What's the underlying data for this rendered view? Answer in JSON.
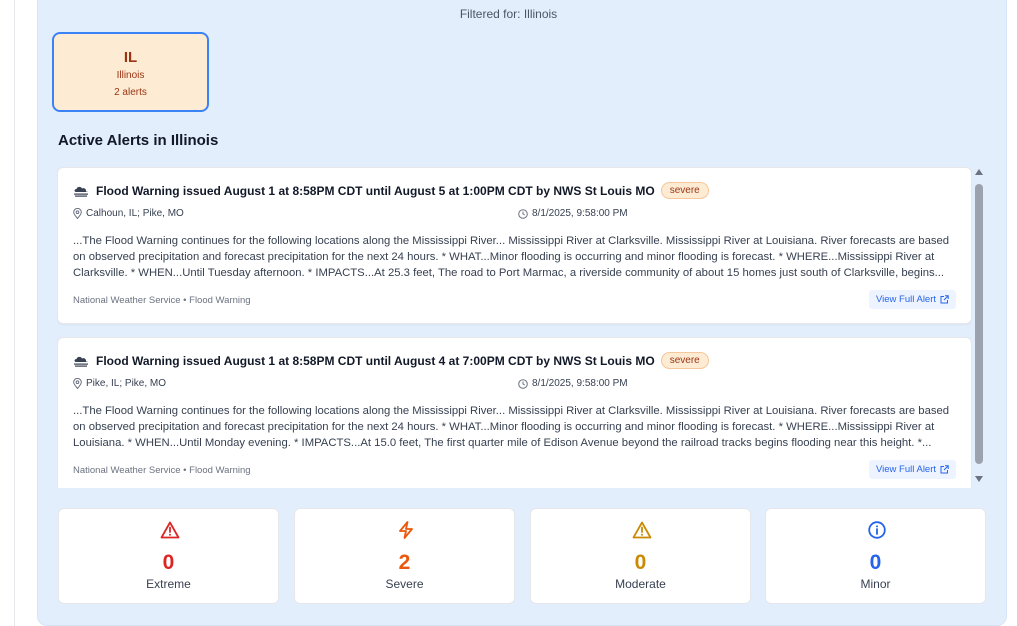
{
  "filter_label": "Filtered for: Illinois",
  "state_card": {
    "code": "IL",
    "name": "Illinois",
    "count": "2 alerts"
  },
  "section_title": "Active Alerts in Illinois",
  "alerts": [
    {
      "title": "Flood Warning issued August 1 at 8:58PM CDT until August 5 at 1:00PM CDT by NWS St Louis MO",
      "severity": "severe",
      "location": "Calhoun, IL; Pike, MO",
      "time": "8/1/2025, 9:58:00 PM",
      "description_lines": [
        "...The Flood Warning continues for the following locations along the Mississippi River... Mississippi River at Clarksville. Mississippi River at Louisiana. River forecasts are based",
        "on observed precipitation and forecast precipitation for the next 24 hours. * WHAT...Minor flooding is occurring and minor flooding is forecast. * WHERE...Mississippi River at",
        "Clarksville. * WHEN...Until Tuesday afternoon. * IMPACTS...At 25.3 feet, The road to Port Marmac, a riverside community of about 15 homes just south of Clarksville, begins..."
      ],
      "source": "National Weather Service • Flood Warning",
      "view_label": "View Full Alert"
    },
    {
      "title": "Flood Warning issued August 1 at 8:58PM CDT until August 4 at 7:00PM CDT by NWS St Louis MO",
      "severity": "severe",
      "location": "Pike, IL; Pike, MO",
      "time": "8/1/2025, 9:58:00 PM",
      "description_lines": [
        "...The Flood Warning continues for the following locations along the Mississippi River... Mississippi River at Clarksville. Mississippi River at Louisiana. River forecasts are based",
        "on observed precipitation and forecast precipitation for the next 24 hours. * WHAT...Minor flooding is occurring and minor flooding is forecast. * WHERE...Mississippi River at",
        "Louisiana. * WHEN...Until Monday evening. * IMPACTS...At 15.0 feet, The first quarter mile of Edison Avenue beyond the railroad tracks begins flooding near this height. *..."
      ],
      "source": "National Weather Service • Flood Warning",
      "view_label": "View Full Alert"
    }
  ],
  "stats": [
    {
      "value": "0",
      "label": "Extreme",
      "icon": "warning-triangle-icon",
      "color": "#dc2626"
    },
    {
      "value": "2",
      "label": "Severe",
      "icon": "lightning-icon",
      "color": "#ea580c"
    },
    {
      "value": "0",
      "label": "Moderate",
      "icon": "warning-triangle-icon",
      "color": "#ca8a04"
    },
    {
      "value": "0",
      "label": "Minor",
      "icon": "info-icon",
      "color": "#2563eb"
    }
  ]
}
